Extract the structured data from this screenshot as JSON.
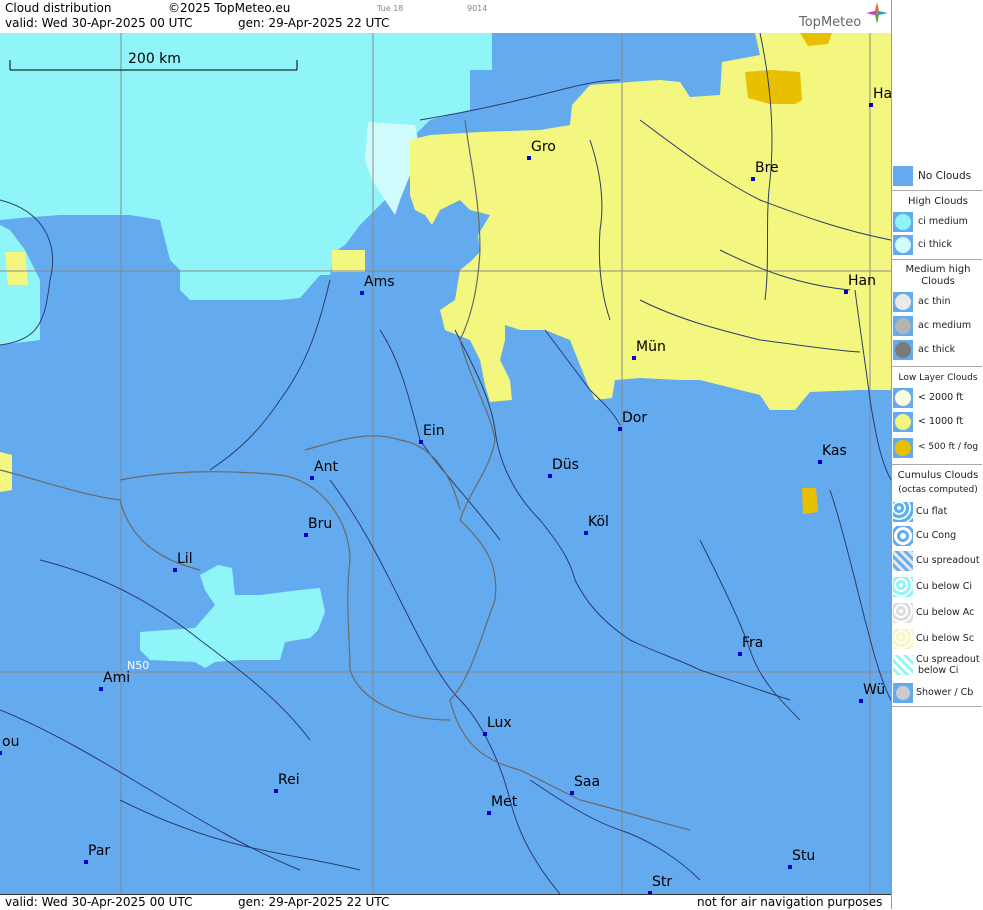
{
  "header": {
    "product": "Cloud distribution",
    "copyright": "©2025 TopMeteo.eu",
    "small_day": "Tue 18",
    "small_code": "9014",
    "valid": "valid:  Wed  30-Apr-2025  00 UTC",
    "gen": "gen: 29-Apr-2025 22 UTC",
    "logo": "TopMeteo"
  },
  "footer": {
    "valid": "valid:  Wed  30-Apr-2025  00 UTC",
    "gen": "gen: 29-Apr-2025 22 UTC",
    "disclaimer": "not for air navigation purposes"
  },
  "map": {
    "scale_label": "200 km",
    "lat_label": "N50",
    "colors": {
      "no_clouds": "#64aaee",
      "ci_medium": "#8ff5f8",
      "ci_thick": "#cffbfd",
      "low_1000": "#f3f77f",
      "low_500": "#e8c000"
    },
    "cities": [
      {
        "name": "Gro"
      },
      {
        "name": "Bre"
      },
      {
        "name": "Ha"
      },
      {
        "name": "Ams"
      },
      {
        "name": "Han"
      },
      {
        "name": "Mün"
      },
      {
        "name": "Dor"
      },
      {
        "name": "Ein"
      },
      {
        "name": "Kas"
      },
      {
        "name": "Ant"
      },
      {
        "name": "Düs"
      },
      {
        "name": "Bru"
      },
      {
        "name": "Köl"
      },
      {
        "name": "Lil"
      },
      {
        "name": "Fra"
      },
      {
        "name": "Ami"
      },
      {
        "name": "Wü"
      },
      {
        "name": "Lux"
      },
      {
        "name": "ou"
      },
      {
        "name": "Rei"
      },
      {
        "name": "Saa"
      },
      {
        "name": "Met"
      },
      {
        "name": "Par"
      },
      {
        "name": "Stu"
      },
      {
        "name": "Str"
      }
    ]
  },
  "legend": {
    "no_clouds": "No Clouds",
    "high_head": "High Clouds",
    "ci_medium": "ci medium",
    "ci_thick": "ci thick",
    "medium_head_1": "Medium high",
    "medium_head_2": "Clouds",
    "ac_thin": "ac thin",
    "ac_medium": "ac medium",
    "ac_thick": "ac thick",
    "low_head": "Low Layer Clouds",
    "low_2000": "< 2000 ft",
    "low_1000": "< 1000 ft",
    "low_500": "< 500 ft / fog",
    "cu_head_1": "Cumulus Clouds",
    "cu_head_2": "(octas computed)",
    "cu_flat": "Cu flat",
    "cu_cong": "Cu Cong",
    "cu_spreadout": "Cu spreadout",
    "cu_below_ci": "Cu below Ci",
    "cu_below_ac": "Cu below Ac",
    "cu_below_sc": "Cu below Sc",
    "cu_spread_below_ci_1": "Cu spreadout",
    "cu_spread_below_ci_2": "below Ci",
    "shower": "Shower / Cb"
  }
}
